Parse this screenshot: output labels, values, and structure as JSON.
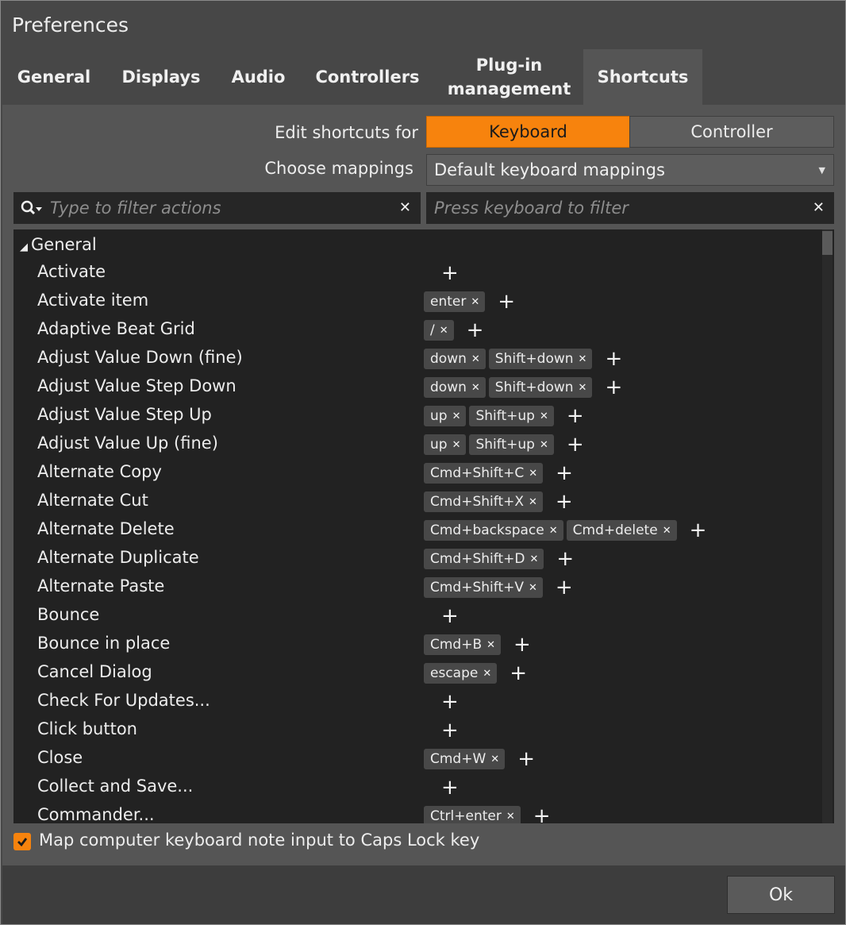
{
  "window": {
    "title": "Preferences"
  },
  "tabs": [
    {
      "label": "General"
    },
    {
      "label": "Displays"
    },
    {
      "label": "Audio"
    },
    {
      "label": "Controllers"
    },
    {
      "label": "Plug-in\nmanagement"
    },
    {
      "label": "Shortcuts",
      "active": true
    }
  ],
  "shortcuts": {
    "edit_label": "Edit shortcuts for",
    "keyboard_label": "Keyboard",
    "controller_label": "Controller",
    "choose_label": "Choose mappings",
    "mapping_value": "Default keyboard mappings",
    "action_filter_placeholder": "Type to filter actions",
    "key_filter_placeholder": "Press keyboard to filter",
    "accent_color": "#f7830d"
  },
  "list": {
    "group_label": "General",
    "rows": [
      {
        "name": "Activate",
        "keys": []
      },
      {
        "name": "Activate item",
        "keys": [
          "enter"
        ]
      },
      {
        "name": "Adaptive Beat Grid",
        "keys": [
          "/"
        ]
      },
      {
        "name": "Adjust Value Down (fine)",
        "keys": [
          "down",
          "Shift+down"
        ]
      },
      {
        "name": "Adjust Value Step Down",
        "keys": [
          "down",
          "Shift+down"
        ]
      },
      {
        "name": "Adjust Value Step Up",
        "keys": [
          "up",
          "Shift+up"
        ]
      },
      {
        "name": "Adjust Value Up (fine)",
        "keys": [
          "up",
          "Shift+up"
        ]
      },
      {
        "name": "Alternate Copy",
        "keys": [
          "Cmd+Shift+C"
        ]
      },
      {
        "name": "Alternate Cut",
        "keys": [
          "Cmd+Shift+X"
        ]
      },
      {
        "name": "Alternate Delete",
        "keys": [
          "Cmd+backspace",
          "Cmd+delete"
        ]
      },
      {
        "name": "Alternate Duplicate",
        "keys": [
          "Cmd+Shift+D"
        ]
      },
      {
        "name": "Alternate Paste",
        "keys": [
          "Cmd+Shift+V"
        ]
      },
      {
        "name": "Bounce",
        "keys": []
      },
      {
        "name": "Bounce in place",
        "keys": [
          "Cmd+B"
        ]
      },
      {
        "name": "Cancel Dialog",
        "keys": [
          "escape"
        ]
      },
      {
        "name": "Check For Updates...",
        "keys": []
      },
      {
        "name": "Click button",
        "keys": []
      },
      {
        "name": "Close",
        "keys": [
          "Cmd+W"
        ]
      },
      {
        "name": "Collect and Save...",
        "keys": []
      },
      {
        "name": "Commander...",
        "keys": [
          "Ctrl+enter"
        ]
      }
    ]
  },
  "footer": {
    "checkbox_label": "Map computer keyboard note input to Caps Lock key",
    "checkbox_checked": true,
    "ok_label": "Ok"
  }
}
